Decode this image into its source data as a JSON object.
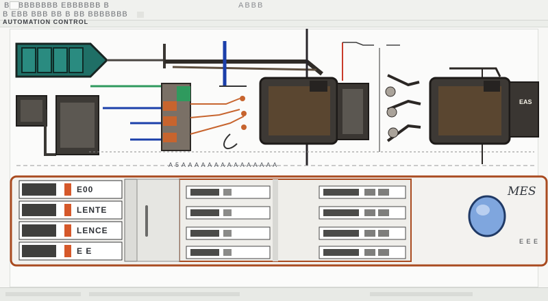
{
  "window": {
    "title_text": "B EBBBBBBB EBBBBBB B",
    "title_secondary": "ABBB",
    "subtitle_text": "B EBB BBB BB B BB BBBBBBB",
    "toolbar_label": "AUTOMATION CONTROL"
  },
  "schematic": {
    "scale_label": "A 5 A A A A A A A A A A A A A A A",
    "chip_right_label": "EAS",
    "colors": {
      "teal": "#1f6f66",
      "dark_module": "#3d3a36",
      "wire_blue": "#1b3faa",
      "wire_red": "#c93b2a",
      "wire_green": "#2f9a5e",
      "copper": "#c7642e",
      "chip_amber": "#e6a63a"
    }
  },
  "rack": {
    "rows": [
      {
        "label": "E00"
      },
      {
        "label": "LENTE"
      },
      {
        "label": "LENCE"
      },
      {
        "label": "E E"
      }
    ],
    "mes_label": "MES",
    "mes_caption": "E E E",
    "colors": {
      "frame": "#a94b20",
      "panel_bg": "#f3f2ef",
      "knob": "#7fa6de",
      "knob_edge": "#203a66"
    }
  }
}
